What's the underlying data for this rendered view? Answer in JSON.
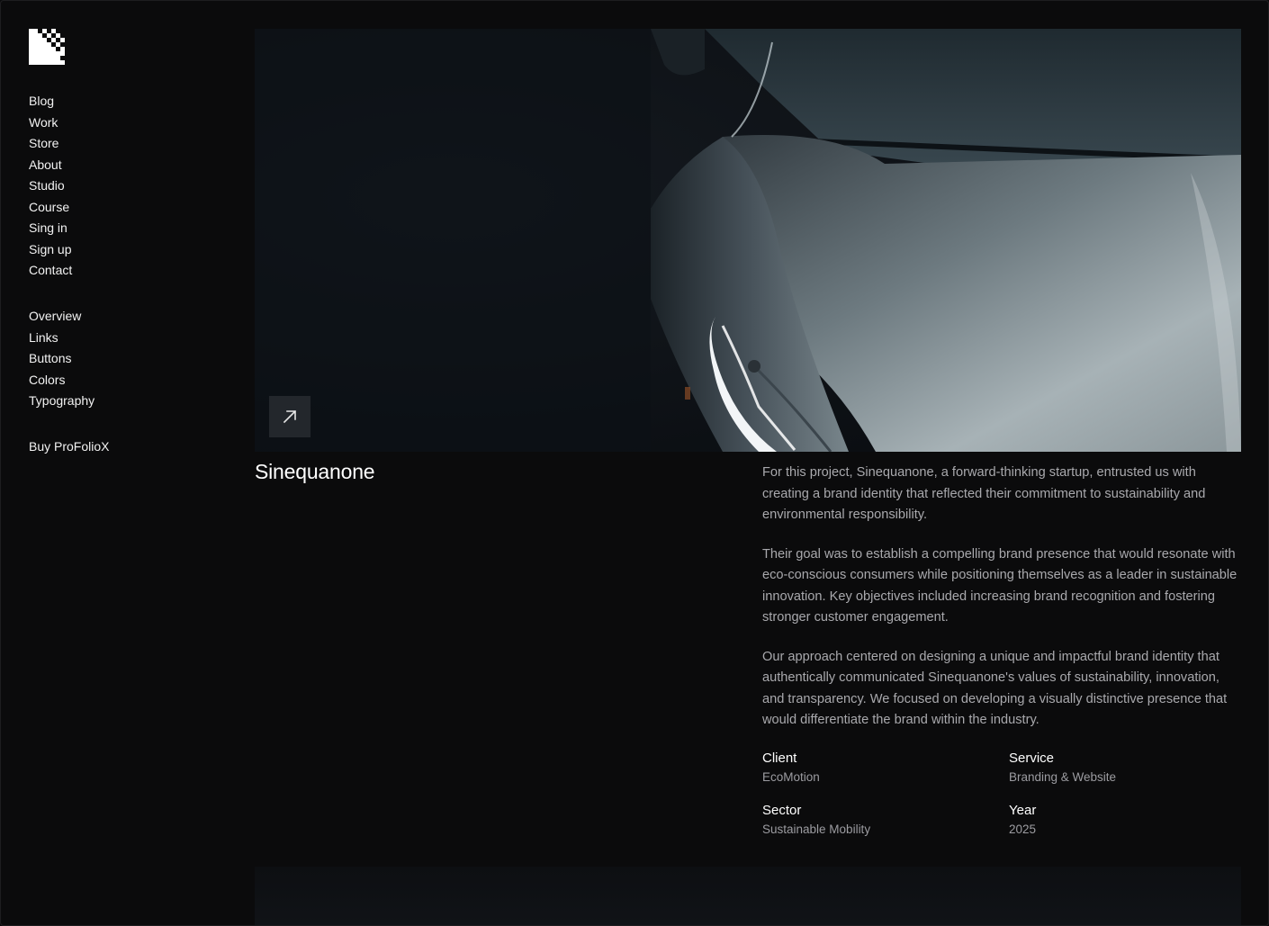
{
  "nav": {
    "primary": [
      "Blog",
      "Work",
      "Store",
      "About",
      "Studio",
      "Course",
      "Sing in",
      "Sign up",
      "Contact"
    ],
    "secondary": [
      "Overview",
      "Links",
      "Buttons",
      "Colors",
      "Typography"
    ],
    "buy": "Buy ProFolioX"
  },
  "project": {
    "title": "Sinequanone",
    "paragraphs": [
      "For this project, Sinequanone, a forward-thinking startup, entrusted us with creating a brand identity that reflected their commitment to sustainability and environmental responsibility.",
      "Their goal was to establish a compelling brand presence that would resonate with eco-conscious consumers while positioning themselves as a leader in sustainable innovation. Key objectives included increasing brand recognition and fostering stronger customer engagement.",
      "Our approach centered on designing a unique and impactful brand identity that authentically communicated Sinequanone's values of sustainability, innovation, and transparency. We focused on developing a visually distinctive presence that would differentiate the brand within the industry."
    ],
    "meta": {
      "client_label": "Client",
      "client_value": "EcoMotion",
      "service_label": "Service",
      "service_value": "Branding & Website",
      "sector_label": "Sector",
      "sector_value": "Sustainable Mobility",
      "year_label": "Year",
      "year_value": "2025"
    }
  },
  "icons": {
    "logo": "checkered-logo-icon",
    "hero_link": "arrow-up-right-icon"
  },
  "colors": {
    "background": "#0b0b0c",
    "text_primary": "#ffffff",
    "text_secondary": "#a9a9ad"
  }
}
